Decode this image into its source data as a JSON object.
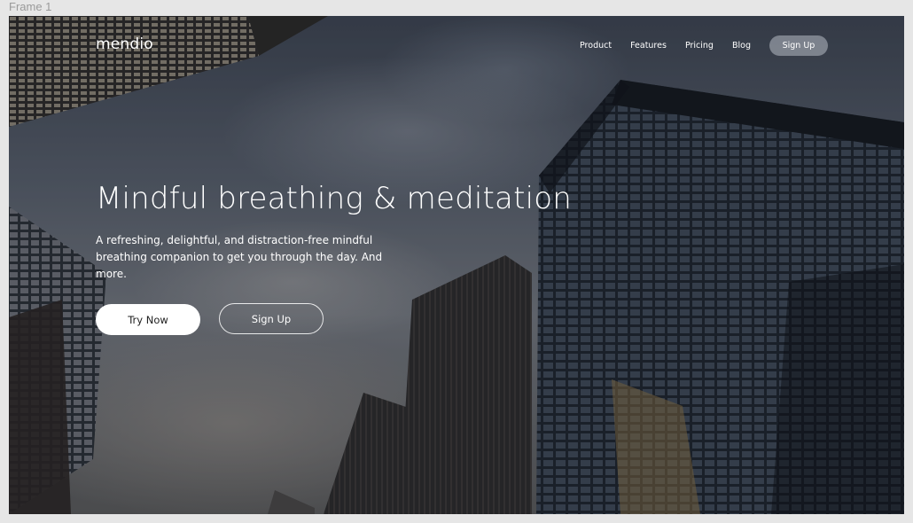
{
  "canvas": {
    "frame_label": "Frame 1"
  },
  "nav": {
    "logo": "mendio",
    "links": [
      "Product",
      "Features",
      "Pricing",
      "Blog"
    ],
    "signup_label": "Sign Up"
  },
  "hero": {
    "title": "Mindful breathing & meditation",
    "subtitle": "A refreshing, delightful, and distraction-free mindful breathing companion to get you through the day. And more.",
    "try_label": "Try Now",
    "signup_label": "Sign Up"
  },
  "colors": {
    "primary_button_bg": "#ffffff",
    "nav_signup_bg": "#a6acb8",
    "text": "#ffffff"
  },
  "background": {
    "icon": "city-skyscrapers-photo"
  }
}
